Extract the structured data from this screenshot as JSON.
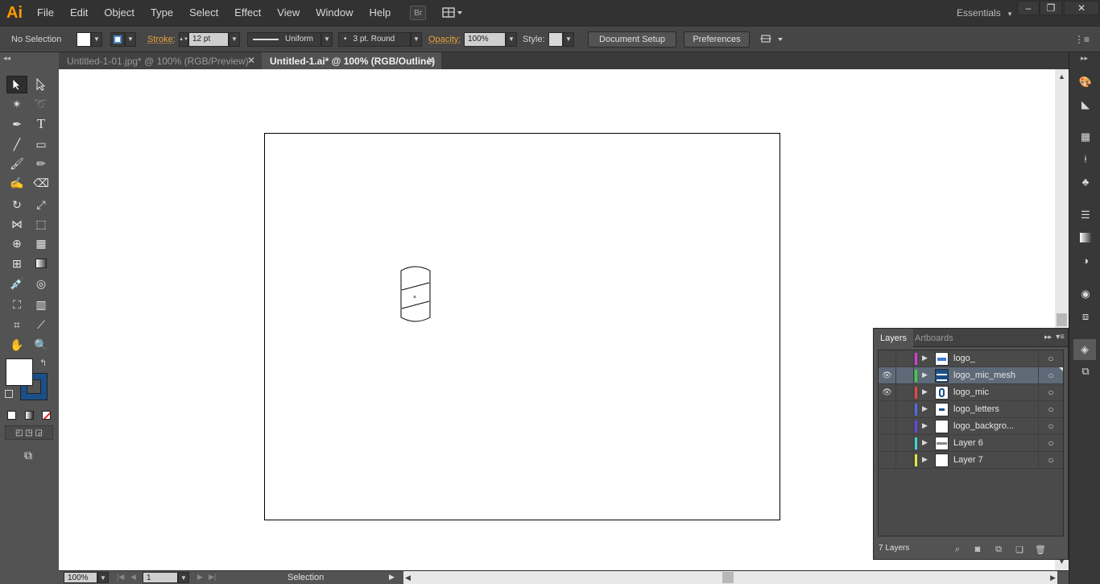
{
  "app": {
    "logo": "Ai"
  },
  "menu": [
    "File",
    "Edit",
    "Object",
    "Type",
    "Select",
    "Effect",
    "View",
    "Window",
    "Help"
  ],
  "menubar": {
    "bridge_label": "Br",
    "workspace": "Essentials"
  },
  "control": {
    "selection_status": "No Selection",
    "stroke_label": "Stroke:",
    "stroke_value": "12 pt",
    "profile": "Uniform",
    "brush": "3 pt. Round",
    "brush_dot": "•",
    "opacity_label": "Opacity:",
    "opacity_value": "100%",
    "style_label": "Style:",
    "document_setup": "Document Setup",
    "preferences": "Preferences"
  },
  "tabs": [
    {
      "label": "Untitled-1-01.jpg* @ 100% (RGB/Preview)",
      "active": false
    },
    {
      "label": "Untitled-1.ai* @ 100% (RGB/Outline)",
      "active": true
    }
  ],
  "tab_close": "✕",
  "layers_panel": {
    "tabs": [
      "Layers",
      "Artboards"
    ],
    "layers": [
      {
        "name": "logo_",
        "color": "#d63ad6",
        "visible": false,
        "selected": false
      },
      {
        "name": "logo_mic_mesh",
        "color": "#3ad63a",
        "visible": true,
        "selected": true
      },
      {
        "name": "logo_mic",
        "color": "#e64646",
        "visible": true,
        "selected": false
      },
      {
        "name": "logo_letters",
        "color": "#4a6de6",
        "visible": false,
        "selected": false
      },
      {
        "name": "logo_backgro...",
        "color": "#5a4ae6",
        "visible": false,
        "selected": false
      },
      {
        "name": "Layer 6",
        "color": "#3ad6d6",
        "visible": false,
        "selected": false
      },
      {
        "name": "Layer 7",
        "color": "#e6e63a",
        "visible": false,
        "selected": false
      }
    ],
    "footer_count": "7 Layers"
  },
  "status": {
    "zoom": "100%",
    "artboard_number": "1",
    "tool": "Selection"
  }
}
